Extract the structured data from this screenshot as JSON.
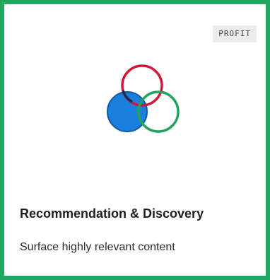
{
  "card": {
    "badge": "PROFIT",
    "title": "Recommendation & Discovery",
    "description": "Surface highly relevant content",
    "icon": "venn-diagram-icon"
  },
  "colors": {
    "border": "#23a65e",
    "badge_bg": "#ececec",
    "circle_red": "#d3173a",
    "circle_blue_fill": "#1a7fdc",
    "circle_blue_stroke": "#0d5aa8",
    "circle_green": "#1fa35f"
  }
}
